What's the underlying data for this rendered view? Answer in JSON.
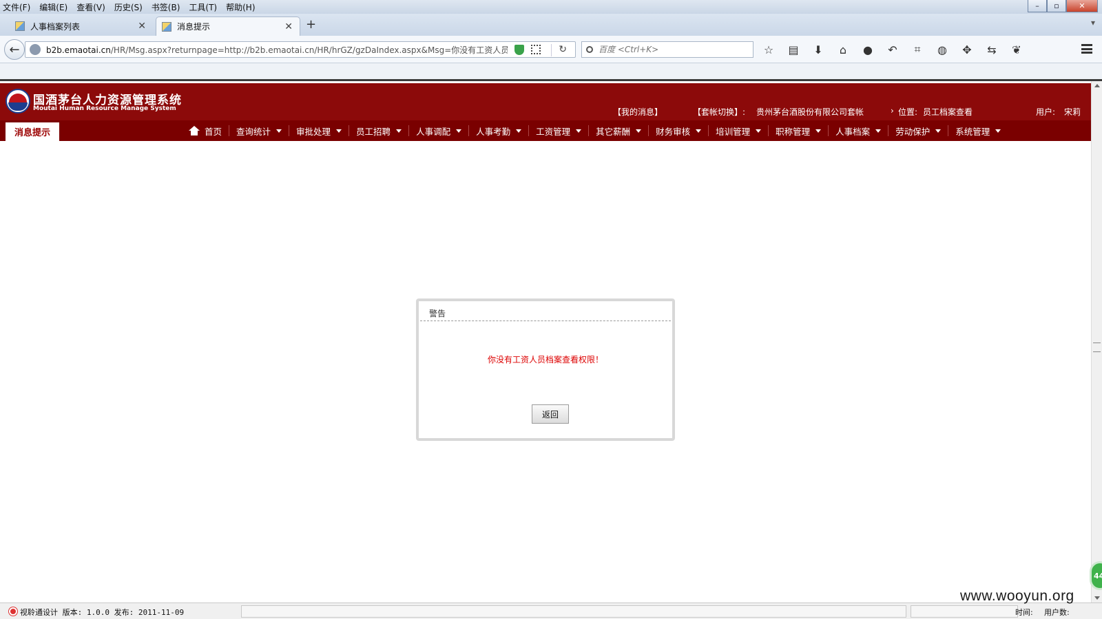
{
  "browser": {
    "menu": [
      "文件(F)",
      "编辑(E)",
      "查看(V)",
      "历史(S)",
      "书签(B)",
      "工具(T)",
      "帮助(H)"
    ],
    "tabs": [
      {
        "label": "人事档案列表",
        "active": false
      },
      {
        "label": "消息提示",
        "active": true
      }
    ],
    "url_host": "b2b.emaotai.cn",
    "url_rest": "/HR/Msg.aspx?returnpage=http://b2b.emaotai.cn/HR/hrGZ/gzDaIndex.aspx&Msg=你没有工资人员档",
    "search_placeholder": "百度 <Ctrl+K>"
  },
  "header": {
    "system_name": "国酒茅台人力资源管理系统",
    "system_name_en": "Moutai Human Resource Manage System",
    "my_messages": "【我的消息】",
    "account_switch_label": "【套帐切换】:",
    "account_switch_value": "贵州茅台酒股份有限公司套帐",
    "location_label": "位置:",
    "location_value": "员工档案查看",
    "user_label": "用户:",
    "user_value": "宋莉"
  },
  "nav": {
    "current_tab": "消息提示",
    "home": "首页",
    "items": [
      "查询统计",
      "审批处理",
      "员工招聘",
      "人事调配",
      "人事考勤",
      "工资管理",
      "其它薪酬",
      "财务审核",
      "培训管理",
      "职称管理",
      "人事档案",
      "劳动保护",
      "系统管理"
    ]
  },
  "dialog": {
    "title": "警告",
    "message": "你没有工资人员档案查看权限！",
    "button": "返回"
  },
  "status": {
    "text": "视聆通设计 版本: 1.0.0 发布: 2011-11-09",
    "time_label": "时间:",
    "users_label": "用户数:"
  },
  "float_badge": "44",
  "watermark": "www.wooyun.org",
  "colors": {
    "header_red": "#8c0a0a",
    "nav_red": "#7a0000",
    "alert_text": "#dd0000"
  }
}
